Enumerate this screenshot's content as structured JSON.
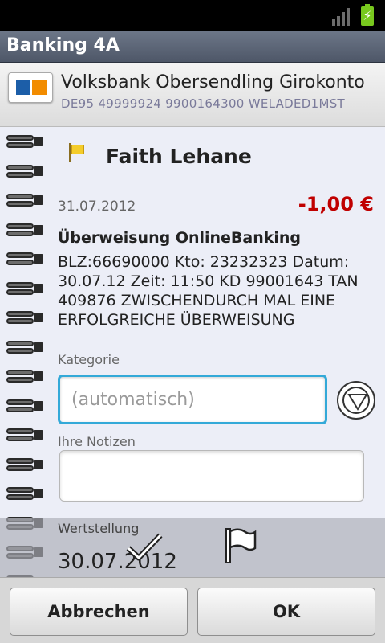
{
  "app": {
    "title": "Banking 4A"
  },
  "account": {
    "name": "Volksbank Obersendling Girokonto",
    "iban": "DE95 49999924 9900164300 WELADED1MST"
  },
  "transaction": {
    "payee": "Faith Lehane",
    "date": "31.07.2012",
    "amount": "-1,00 €",
    "type": "Überweisung OnlineBanking",
    "purpose": "BLZ:66690000 Kto:  23232323 Datum: 30.07.12 Zeit: 11:50 KD   99001643 TAN 409876 ZWISCHENDURCH MAL EINE ERFOLGREICHE ÜBERWEISUNG"
  },
  "form": {
    "category_label": "Kategorie",
    "category_placeholder": "(automatisch)",
    "notes_label": "Ihre Notizen",
    "notes_value": "",
    "value_date_label": "Wertstellung",
    "value_date": "30.07.2012"
  },
  "buttons": {
    "cancel": "Abbrechen",
    "ok": "OK"
  },
  "icons": {
    "signal": "signal-bars-icon",
    "battery": "battery-charging-icon",
    "bank": "volksbank-logo-icon",
    "flag": "flag-icon",
    "dropdown": "dropdown-circle-icon",
    "check": "check-icon"
  },
  "colors": {
    "amount_negative": "#c00000",
    "input_focus": "#33a9d8"
  }
}
